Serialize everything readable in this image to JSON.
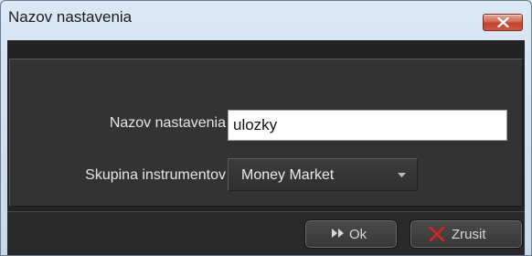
{
  "window": {
    "title": "Nazov nastavenia",
    "close_icon": "close-x-icon"
  },
  "form": {
    "name_label": "Nazov nastavenia",
    "name_value": "ulozky",
    "group_label": "Skupina instrumentov",
    "group_value": "Money Market",
    "group_dropdown_icon": "dropdown-arrow-icon"
  },
  "buttons": {
    "ok_label": "Ok",
    "ok_icon": "fast-forward-icon",
    "cancel_label": "Zrusit",
    "cancel_icon": "red-x-icon"
  },
  "colors": {
    "titlebar": "#cfe0f1",
    "client_background": "#232323",
    "panel_background": "#333333",
    "label_text": "#e6e6e6",
    "close_button": "#c2402a",
    "cancel_icon": "#e02020"
  }
}
